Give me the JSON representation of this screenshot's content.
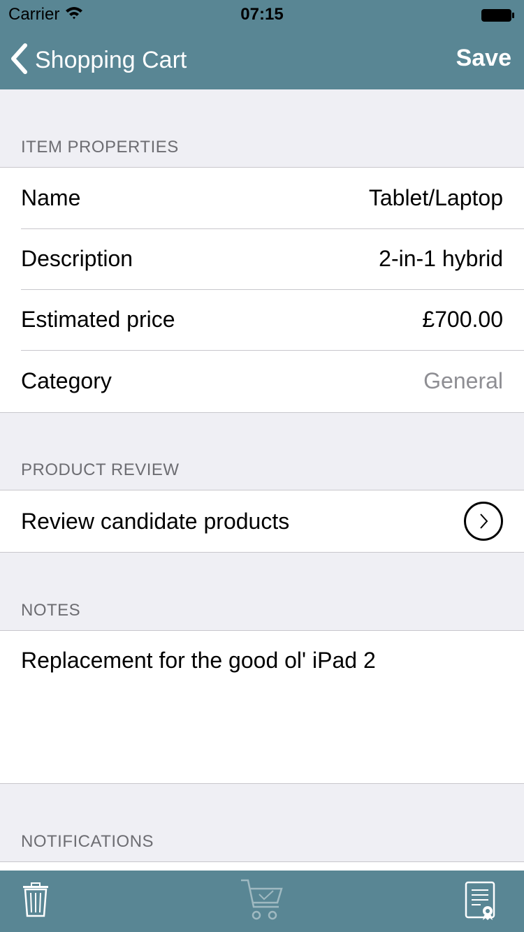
{
  "status_bar": {
    "carrier": "Carrier",
    "time": "07:15"
  },
  "nav": {
    "back_label": "Shopping Cart",
    "save_label": "Save"
  },
  "sections": {
    "item_properties": {
      "header": "ITEM PROPERTIES",
      "rows": [
        {
          "label": "Name",
          "value": "Tablet/Laptop"
        },
        {
          "label": "Description",
          "value": "2-in-1 hybrid"
        },
        {
          "label": "Estimated price",
          "value": "£700.00"
        },
        {
          "label": "Category",
          "value": "General"
        }
      ]
    },
    "product_review": {
      "header": "PRODUCT REVIEW",
      "row_label": "Review candidate products"
    },
    "notes": {
      "header": "NOTES",
      "text": "Replacement for the good ol' iPad 2"
    },
    "notifications": {
      "header": "NOTIFICATIONS"
    }
  },
  "toolbar": {
    "icons": [
      "trash-icon",
      "cart-check-icon",
      "certificate-icon"
    ]
  },
  "colors": {
    "bar": "#598694",
    "background": "#efeff4",
    "placeholder": "#8e8e93"
  }
}
